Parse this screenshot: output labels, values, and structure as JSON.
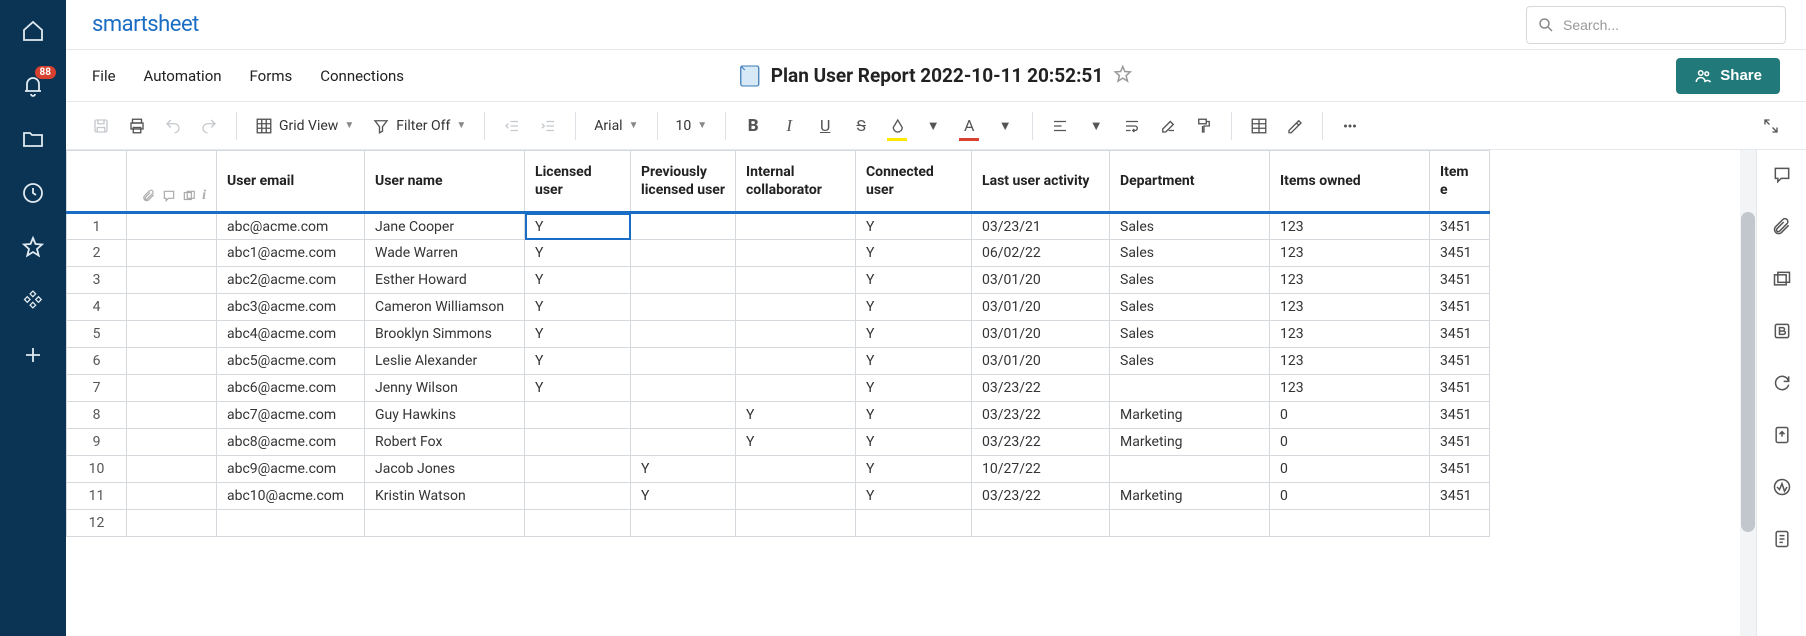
{
  "app_name": "smartsheet",
  "notification_count": "88",
  "search": {
    "placeholder": "Search..."
  },
  "menu": {
    "file": "File",
    "automation": "Automation",
    "forms": "Forms",
    "connections": "Connections"
  },
  "document": {
    "title": "Plan User Report 2022-10-11 20:52:51"
  },
  "share_label": "Share",
  "toolbar": {
    "view_label": "Grid View",
    "filter_label": "Filter Off",
    "font_family": "Arial",
    "font_size": "10"
  },
  "columns": {
    "email": "User email",
    "name": "User name",
    "licensed": "Licensed user",
    "prev_licensed": "Previously licensed user",
    "internal": "Internal collaborator",
    "connected": "Connected user",
    "activity": "Last user activity",
    "department": "Department",
    "items_owned": "Items owned",
    "item_e": "Item e"
  },
  "rows": [
    {
      "n": "1",
      "email": "abc@acme.com",
      "name": "Jane Cooper",
      "licensed": "Y",
      "prev": "",
      "internal": "",
      "connected": "Y",
      "activity": "03/23/21",
      "dept": "Sales",
      "items": "123",
      "ie": "3451"
    },
    {
      "n": "2",
      "email": "abc1@acme.com",
      "name": "Wade Warren",
      "licensed": "Y",
      "prev": "",
      "internal": "",
      "connected": "Y",
      "activity": "06/02/22",
      "dept": "Sales",
      "items": "123",
      "ie": "3451"
    },
    {
      "n": "3",
      "email": "abc2@acme.com",
      "name": "Esther Howard",
      "licensed": "Y",
      "prev": "",
      "internal": "",
      "connected": "Y",
      "activity": "03/01/20",
      "dept": "Sales",
      "items": "123",
      "ie": "3451"
    },
    {
      "n": "4",
      "email": "abc3@acme.com",
      "name": "Cameron Williamson",
      "licensed": "Y",
      "prev": "",
      "internal": "",
      "connected": "Y",
      "activity": "03/01/20",
      "dept": "Sales",
      "items": "123",
      "ie": "3451"
    },
    {
      "n": "5",
      "email": "abc4@acme.com",
      "name": "Brooklyn Simmons",
      "licensed": "Y",
      "prev": "",
      "internal": "",
      "connected": "Y",
      "activity": "03/01/20",
      "dept": "Sales",
      "items": "123",
      "ie": "3451"
    },
    {
      "n": "6",
      "email": "abc5@acme.com",
      "name": "Leslie Alexander",
      "licensed": "Y",
      "prev": "",
      "internal": "",
      "connected": "Y",
      "activity": "03/01/20",
      "dept": "Sales",
      "items": "123",
      "ie": "3451"
    },
    {
      "n": "7",
      "email": "abc6@acme.com",
      "name": "Jenny Wilson",
      "licensed": "Y",
      "prev": "",
      "internal": "",
      "connected": "Y",
      "activity": "03/23/22",
      "dept": "",
      "items": "123",
      "ie": "3451"
    },
    {
      "n": "8",
      "email": "abc7@acme.com",
      "name": "Guy Hawkins",
      "licensed": "",
      "prev": "",
      "internal": "Y",
      "connected": "Y",
      "activity": "03/23/22",
      "dept": "Marketing",
      "items": "0",
      "ie": "3451"
    },
    {
      "n": "9",
      "email": "abc8@acme.com",
      "name": "Robert Fox",
      "licensed": "",
      "prev": "",
      "internal": "Y",
      "connected": "Y",
      "activity": "03/23/22",
      "dept": "Marketing",
      "items": "0",
      "ie": "3451"
    },
    {
      "n": "10",
      "email": "abc9@acme.com",
      "name": "Jacob Jones",
      "licensed": "",
      "prev": "Y",
      "internal": "",
      "connected": "Y",
      "activity": "10/27/22",
      "dept": "",
      "items": "0",
      "ie": "3451"
    },
    {
      "n": "11",
      "email": "abc10@acme.com",
      "name": "Kristin Watson",
      "licensed": "",
      "prev": "Y",
      "internal": "",
      "connected": "Y",
      "activity": "03/23/22",
      "dept": "Marketing",
      "items": "0",
      "ie": "3451"
    },
    {
      "n": "12",
      "email": "",
      "name": "",
      "licensed": "",
      "prev": "",
      "internal": "",
      "connected": "",
      "activity": "",
      "dept": "",
      "items": "",
      "ie": ""
    }
  ]
}
